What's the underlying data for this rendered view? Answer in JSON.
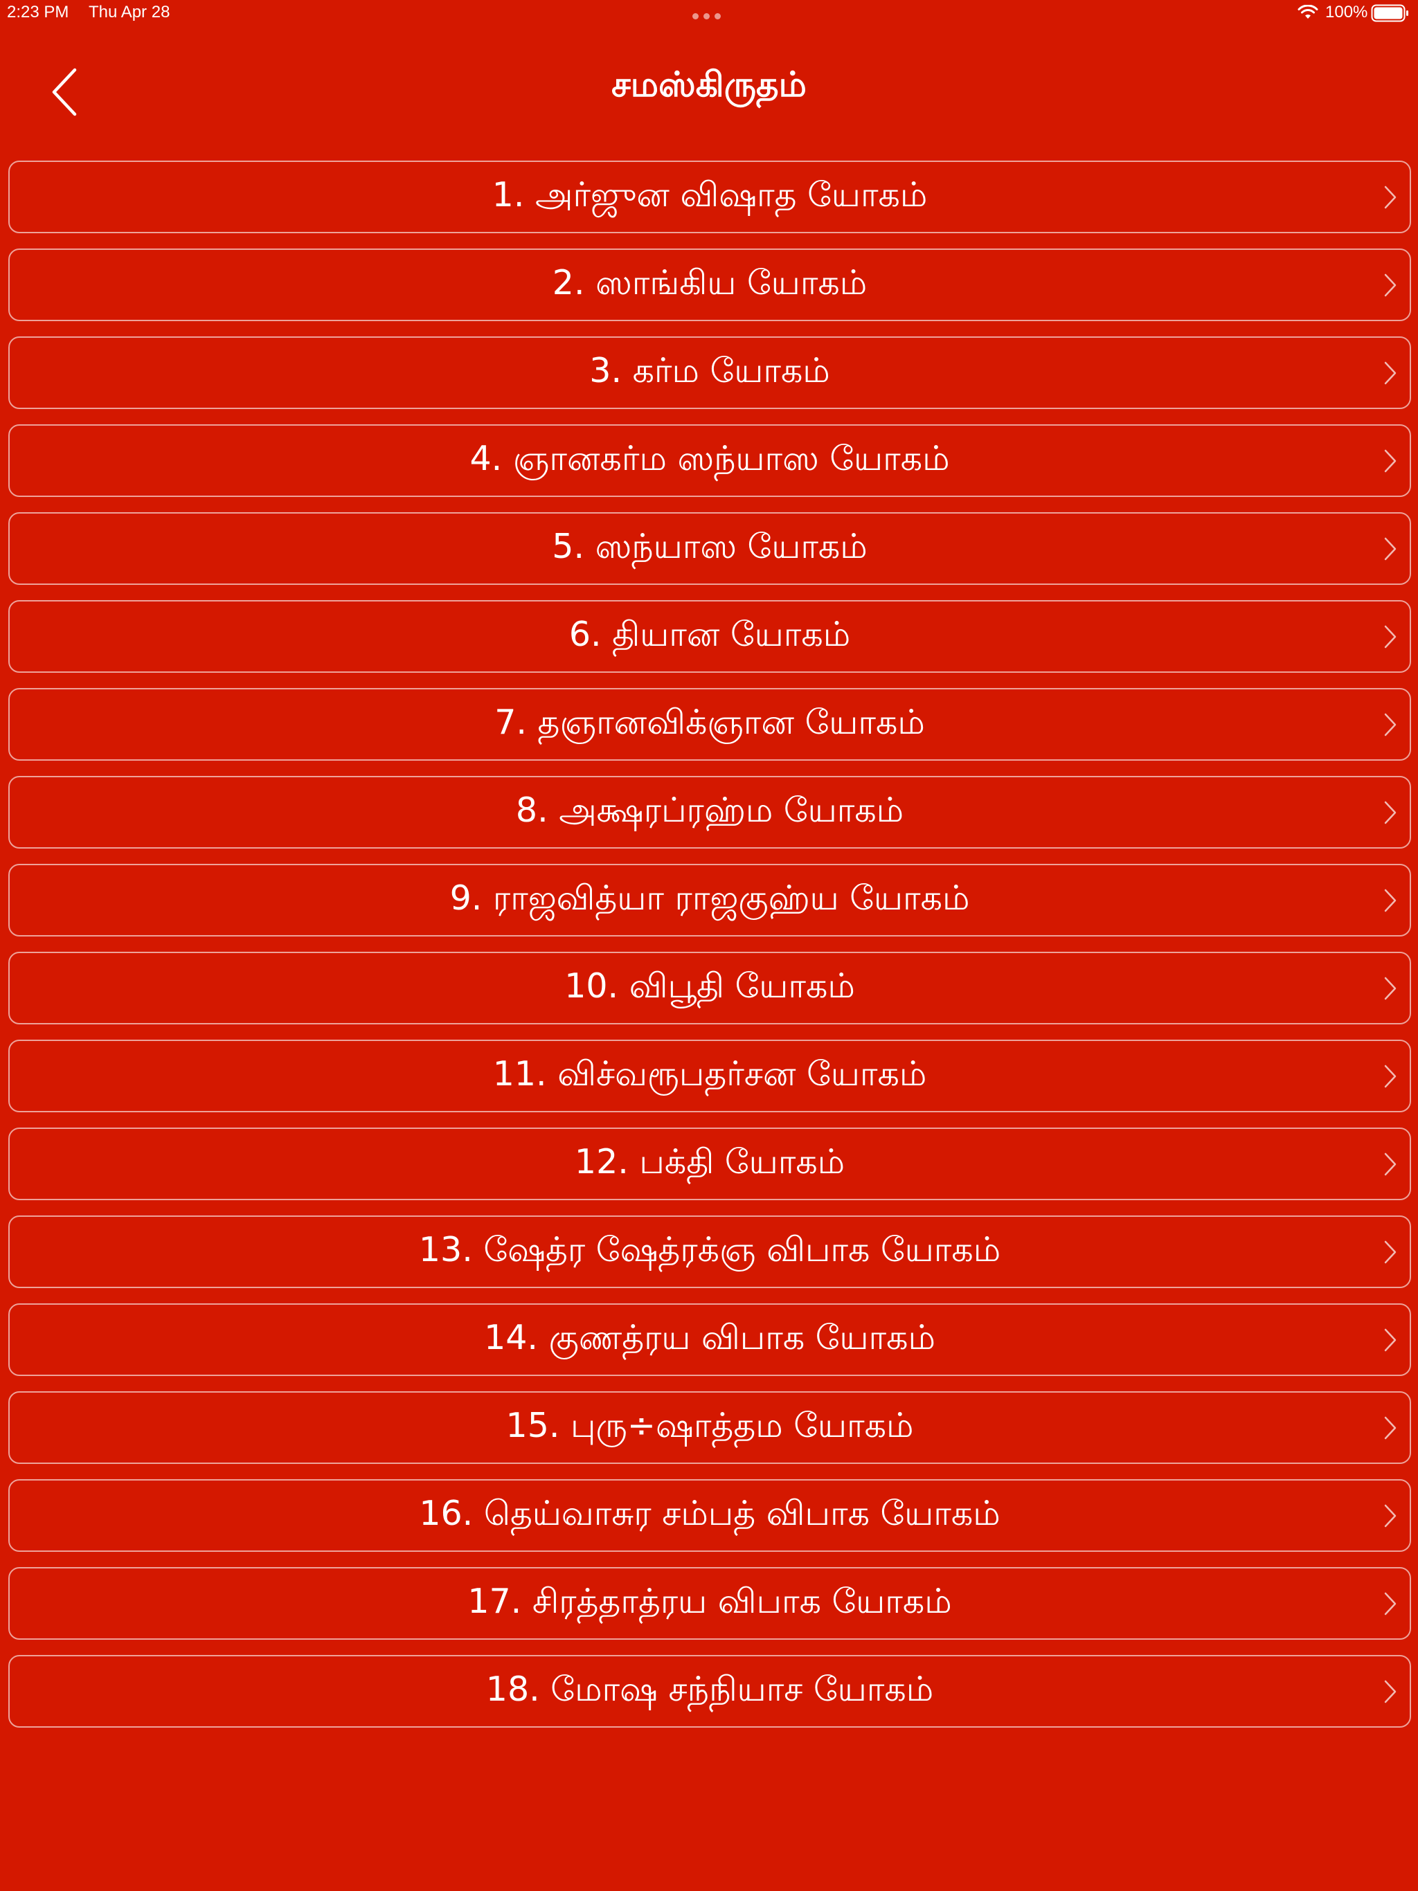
{
  "status_bar": {
    "time": "2:23 PM",
    "date": "Thu Apr 28",
    "battery": "100%"
  },
  "header": {
    "title": "சமஸ்கிருதம்",
    "back_icon": "chevron-left-icon"
  },
  "chapters": [
    {
      "label": "1. அர்ஜுன விஷாத யோகம்"
    },
    {
      "label": "2. ஸாங்கிய யோகம்"
    },
    {
      "label": "3. கர்ம யோகம்"
    },
    {
      "label": "4. ஞானகர்ம ஸந்யாஸ யோகம்"
    },
    {
      "label": "5. ஸந்யாஸ யோகம்"
    },
    {
      "label": "6. தியான யோகம்"
    },
    {
      "label": "7. தஞானவிக்ஞான யோகம்"
    },
    {
      "label": "8. அக்ஷரப்ரஹ்ம யோகம்"
    },
    {
      "label": "9. ராஜவித்யா ராஜகுஹ்ய யோகம்"
    },
    {
      "label": "10. விபூதி யோகம்"
    },
    {
      "label": "11. விச்வரூபதர்சன யோகம்"
    },
    {
      "label": "12. பக்தி யோகம்"
    },
    {
      "label": "13. ஷேத்ர ஷேத்ரக்ஞ விபாக யோகம்"
    },
    {
      "label": "14. குணத்ரய விபாக யோகம்"
    },
    {
      "label": "15. புரு÷ஷாத்தம யோகம்"
    },
    {
      "label": "16. தெய்வாசுர சம்பத் விபாக யோகம்"
    },
    {
      "label": "17. சிரத்தாத்ரய விபாக யோகம்"
    },
    {
      "label": "18. மோஷ சந்நியாச யோகம்"
    }
  ],
  "colors": {
    "background": "#d41800",
    "text": "#ffffff"
  }
}
